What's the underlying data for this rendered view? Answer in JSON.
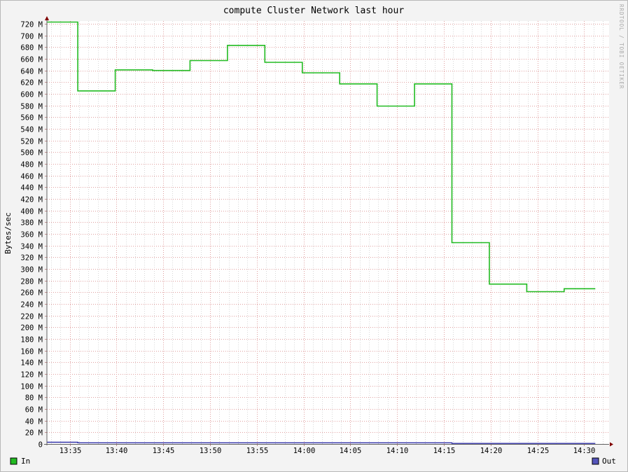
{
  "chart_data": {
    "type": "line",
    "title": "compute Cluster Network last hour",
    "ylabel": "Bytes/sec",
    "watermark": "RRDTOOL / TOBI OETIKER",
    "ylim": [
      0,
      720
    ],
    "y_unit_suffix": "M",
    "x_ticks": [
      "13:35",
      "13:40",
      "13:45",
      "13:50",
      "13:55",
      "14:00",
      "14:05",
      "14:10",
      "14:15",
      "14:20",
      "14:25",
      "14:30"
    ],
    "x_range_minutes": [
      -2.5,
      57
    ],
    "grid": true,
    "background": "#ffffff",
    "grid_color": "#e0a0a0",
    "axis_color": "#800000",
    "series": [
      {
        "name": "In",
        "color": "#22bb22",
        "step": true,
        "x_minutes": [
          -2.5,
          0.87,
          4.87,
          8.87,
          12.87,
          16.87,
          20.87,
          24.87,
          28.87,
          32.87,
          36.87,
          40.87,
          44.87,
          48.87,
          52.87,
          56.2
        ],
        "values": [
          723,
          605,
          641,
          640,
          657,
          683,
          654,
          636,
          617,
          579,
          617,
          345,
          274,
          261,
          266,
          266
        ]
      },
      {
        "name": "Out",
        "color": "#3333aa",
        "step": true,
        "x_minutes": [
          -2.5,
          0.87,
          40.87,
          56.2
        ],
        "values": [
          3,
          2,
          1,
          1
        ]
      }
    ],
    "legend": [
      {
        "name": "In",
        "color": "#22bb22",
        "position": "bottom-left"
      },
      {
        "name": "Out",
        "color": "#5555bb",
        "position": "bottom-right"
      }
    ]
  }
}
